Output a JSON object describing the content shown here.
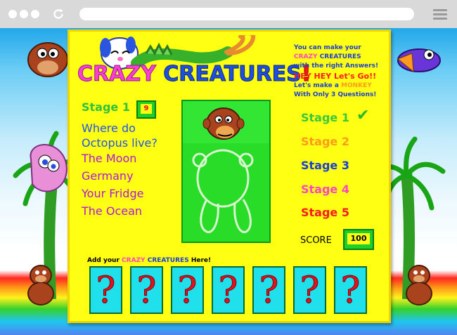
{
  "browser": {
    "icons": [
      "dot-icon",
      "dot-icon",
      "dot-icon",
      "reload-icon",
      "hamburger-menu-icon"
    ]
  },
  "title": {
    "crazy": "CRAZY",
    "creatures": "CREATURES",
    "bang": "!"
  },
  "intro": {
    "line1": "You can make your",
    "line2a": "CRAZY",
    "line2b": "CREATURES",
    "line3": "with the right Answers!",
    "line4": "HEY HEY Let's Go!!",
    "line5a": "Let's make a",
    "line5b": "MONKEY",
    "line6": "With Only 3 Questions!"
  },
  "question_panel": {
    "stage_label": "Stage 1",
    "counter": "9",
    "question": [
      "Where do",
      "Octopus live?"
    ],
    "answers": [
      "The Moon",
      "Germany",
      "Your Fridge",
      "The Ocean"
    ]
  },
  "stages": [
    {
      "label": "Stage 1",
      "color": "#3bc83a",
      "done": true,
      "check": "✔"
    },
    {
      "label": "Stage 2",
      "color": "#ff9a1c",
      "done": false
    },
    {
      "label": "Stage 3",
      "color": "#1b3fd0",
      "done": false
    },
    {
      "label": "Stage 4",
      "color": "#ff45c0",
      "done": false
    },
    {
      "label": "Stage 5",
      "color": "#ff1a1a",
      "done": false
    }
  ],
  "score": {
    "label": "SCORE",
    "value": "100"
  },
  "add_creatures": {
    "prefix": "Add your",
    "crazy": "CRAZY",
    "creatures": "CREATURES",
    "suffix": "Here!"
  },
  "slots": [
    "?",
    "?",
    "?",
    "?",
    "?",
    "?",
    "?"
  ],
  "colors": {
    "board": "#ffff14",
    "panel_green": "#28dc28",
    "question_blue": "#2255e6",
    "answer_purple": "#b018d6",
    "slot_cyan": "#1fe0eb",
    "slot_mark_red": "#e1121b"
  }
}
